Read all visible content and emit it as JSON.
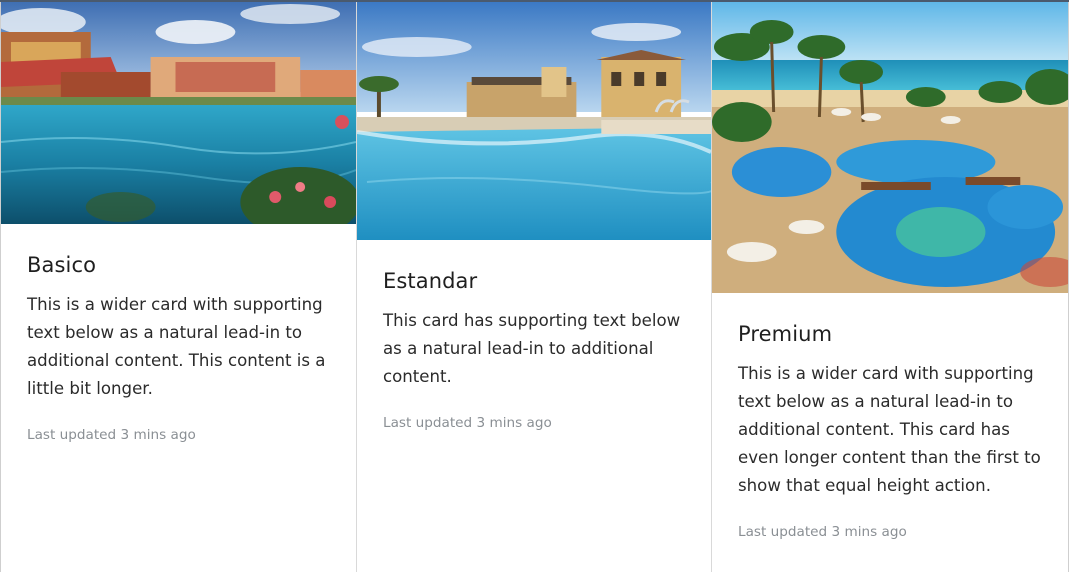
{
  "cards": [
    {
      "title": "Basico",
      "text": "This is a wider card with supporting text below as a natural lead-in to additional content. This content is a little bit longer.",
      "updated": "Last updated 3 mins ago",
      "image_icon": "resort-pool-photo"
    },
    {
      "title": "Estandar",
      "text": "This card has supporting text below as a natural lead-in to additional content.",
      "updated": "Last updated 3 mins ago",
      "image_icon": "hotel-pool-photo"
    },
    {
      "title": "Premium",
      "text": "This is a wider card with supporting text below as a natural lead-in to additional content. This card has even longer content than the first to show that equal height action.",
      "updated": "Last updated 3 mins ago",
      "image_icon": "beach-resort-pool-photo"
    }
  ],
  "colors": {
    "title": "#1f1f1f",
    "text": "#2b2b2b",
    "muted": "#8a8f94",
    "border": "#d9d9d9"
  }
}
